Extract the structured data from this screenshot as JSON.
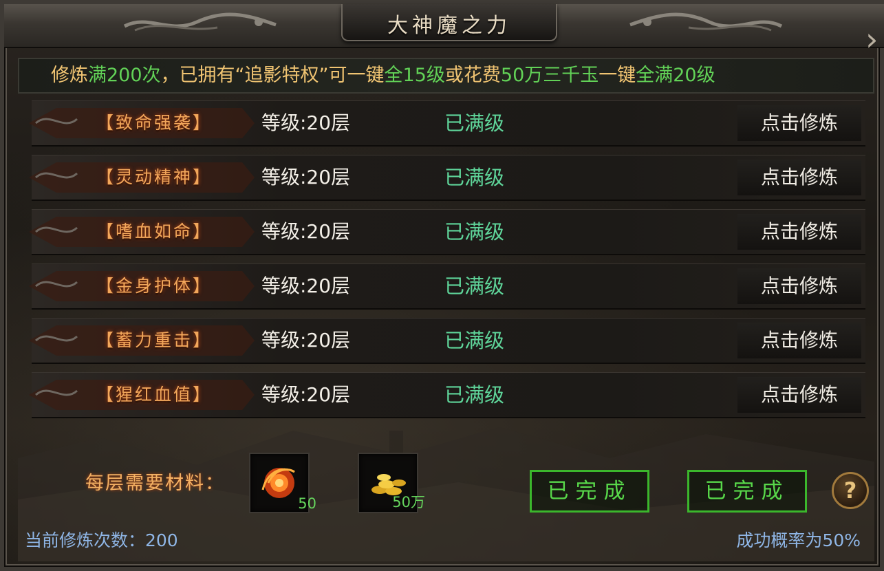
{
  "title": "大神魔之力",
  "notice": {
    "segments": [
      {
        "text": "修炼",
        "color": "orange"
      },
      {
        "text": "满200次",
        "color": "green"
      },
      {
        "text": "，已拥有“追影特权”可一键",
        "color": "orange"
      },
      {
        "text": "全15级",
        "color": "green"
      },
      {
        "text": "或花费",
        "color": "orange"
      },
      {
        "text": "50万三千玉",
        "color": "green"
      },
      {
        "text": "一键",
        "color": "orange"
      },
      {
        "text": "全满20级",
        "color": "green"
      }
    ]
  },
  "rows": [
    {
      "name": "【致命强袭】",
      "level": "等级:20层",
      "status": "已满级",
      "button": "点击修炼"
    },
    {
      "name": "【灵动精神】",
      "level": "等级:20层",
      "status": "已满级",
      "button": "点击修炼"
    },
    {
      "name": "【嗜血如命】",
      "level": "等级:20层",
      "status": "已满级",
      "button": "点击修炼"
    },
    {
      "name": "【金身护体】",
      "level": "等级:20层",
      "status": "已满级",
      "button": "点击修炼"
    },
    {
      "name": "【蓄力重击】",
      "level": "等级:20层",
      "status": "已满级",
      "button": "点击修炼"
    },
    {
      "name": "【猩红血值】",
      "level": "等级:20层",
      "status": "已满级",
      "button": "点击修炼"
    }
  ],
  "materials": {
    "label": "每层需要材料：",
    "items": [
      {
        "icon": "fire-orb-icon",
        "count": "50"
      },
      {
        "icon": "gold-coins-icon",
        "count": "50万"
      }
    ]
  },
  "done_buttons": [
    "已完成",
    "已完成"
  ],
  "help_label": "?",
  "current_count": "当前修炼次数：200",
  "success_rate": "成功概率为50%",
  "colors": {
    "orange_text": "#f0c472",
    "green_text": "#62d257",
    "status_green": "#5fd59a",
    "blue_text": "#8fb6e6",
    "done_green": "#3bb72c"
  }
}
